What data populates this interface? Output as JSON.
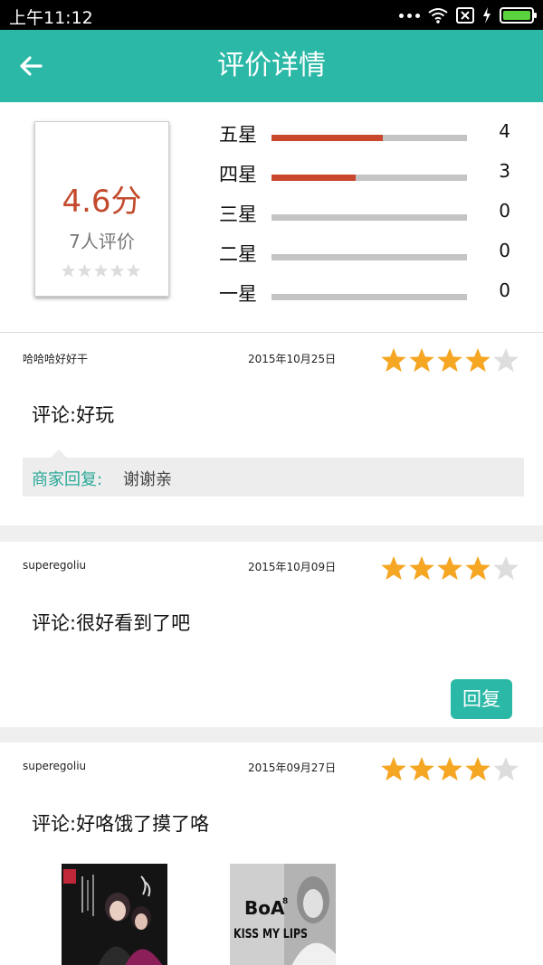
{
  "status_bar": {
    "time": "上午11:12"
  },
  "header": {
    "title": "评价详情"
  },
  "summary": {
    "score": "4.6分",
    "count_text": "7人评价",
    "distribution": [
      {
        "label": "五星",
        "count": "4",
        "fraction": 0.571
      },
      {
        "label": "四星",
        "count": "3",
        "fraction": 0.429
      },
      {
        "label": "三星",
        "count": "0",
        "fraction": 0
      },
      {
        "label": "二星",
        "count": "0",
        "fraction": 0
      },
      {
        "label": "一星",
        "count": "0",
        "fraction": 0
      }
    ]
  },
  "colors": {
    "accent": "#2bb8a6",
    "score": "#c34a2c",
    "star_on": "#f5a623",
    "star_off": "#dddddd"
  },
  "reviews": [
    {
      "user": "哈哈哈好好干",
      "date": "2015年10月25日",
      "rating": 4,
      "comment": "评论:好玩",
      "reply_label": "商家回复:",
      "reply_text": "谢谢亲"
    },
    {
      "user": "superegoliu",
      "date": "2015年10月09日",
      "rating": 4,
      "comment": "评论:很好看到了吧",
      "reply_button": "回复"
    },
    {
      "user": "superegoliu",
      "date": "2015年09月27日",
      "rating": 4,
      "comment": "评论:好咯饿了摸了咯",
      "images": [
        {
          "name": "album-cover-image"
        },
        {
          "name": "boa-kiss-my-lips-cover-image",
          "text_top": "BoA",
          "text_sup": "8",
          "text_bottom": "KISS MY LIPS"
        }
      ]
    }
  ]
}
